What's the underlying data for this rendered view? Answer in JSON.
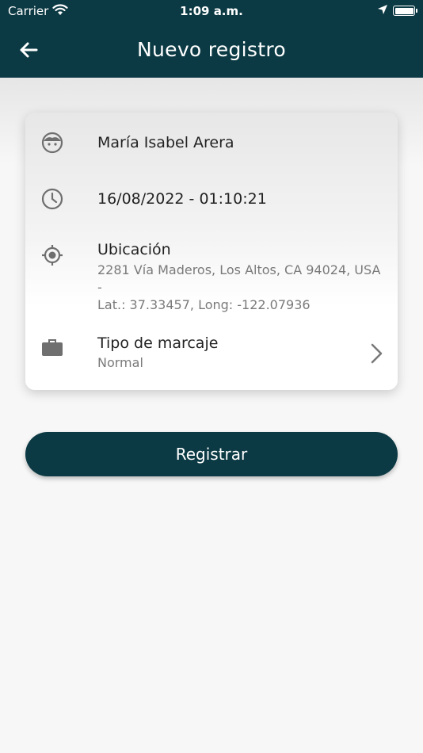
{
  "status_bar": {
    "carrier": "Carrier",
    "time": "1:09 a.m."
  },
  "header": {
    "title": "Nuevo registro",
    "back_icon": "arrow-left-icon",
    "background_color": "#0c3a44"
  },
  "card": {
    "user": {
      "icon": "face-icon",
      "name": "María Isabel Arera"
    },
    "datetime": {
      "icon": "clock-icon",
      "value": "16/08/2022 - 01:10:21"
    },
    "location": {
      "icon": "crosshair-icon",
      "label": "Ubicación",
      "address": "2281 Vía Maderos, Los Altos, CA 94024, USA -",
      "coords": "Lat.: 37.33457, Long: -122.07936"
    },
    "type": {
      "icon": "briefcase-icon",
      "label": "Tipo de marcaje",
      "value": "Normal",
      "chevron_icon": "chevron-right-icon"
    }
  },
  "register_button": {
    "label": "Registrar",
    "color": "#0c3a44"
  }
}
